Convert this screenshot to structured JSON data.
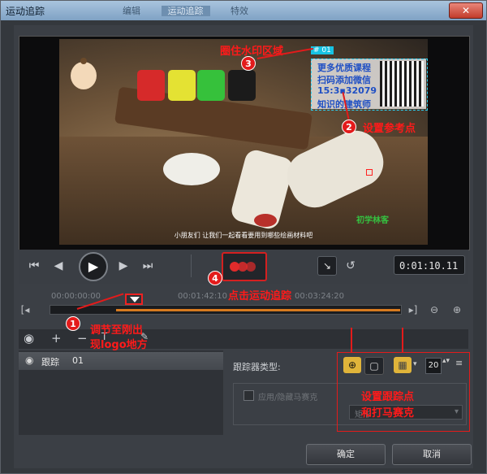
{
  "window": {
    "title": "运动追踪",
    "close_label": "✕"
  },
  "tabs": [
    "编辑",
    "运动追踪",
    "特效"
  ],
  "video": {
    "watermark_tag": "# 01",
    "watermark_lines": [
      "更多优质课程",
      "扫码添加微信",
      "15:3▪32079",
      "知识的建筑师"
    ],
    "subtitle": "小朋友们 让我们一起看看要用到哪些绘画材料吧",
    "green_logo": "初学林客"
  },
  "controls": {
    "prev_clip_icon": "skip-start-icon",
    "prev_frame_icon": "step-back-icon",
    "play_icon": "play-icon",
    "next_frame_icon": "step-forward-icon",
    "next_clip_icon": "skip-end-icon",
    "track_motion_icon": "motion-track-icon",
    "timecode": "0:01:10.11"
  },
  "timeline": {
    "tick_labels": [
      "00:00:00:00",
      "00:01:42:10",
      "00:03:24:20"
    ],
    "zoom_out": "⊖",
    "zoom_in": "⊕"
  },
  "track_list": [
    {
      "name": "跟踪",
      "number": "01"
    }
  ],
  "tracker": {
    "type_label": "跟踪器类型:",
    "size_value": "20",
    "option_label": "应用/隐藏马赛克",
    "dropdown_value": "矩形"
  },
  "footer": {
    "ok_label": "确定",
    "cancel_label": "取消"
  },
  "annotations": {
    "n1": "1",
    "n2": "2",
    "n3": "3",
    "n4": "4",
    "a1": "调节至刚出",
    "a1b": "现logo地方",
    "a2": "设置参考点",
    "a3": "圈住水印区域",
    "a4": "点击运动追踪",
    "a5": "设置跟踪点",
    "a5b": "和打马赛克"
  },
  "colors": {
    "accent_red": "#e31b1b",
    "progress_orange": "#d77a1f",
    "watermark_cyan": "#17c3e3"
  }
}
